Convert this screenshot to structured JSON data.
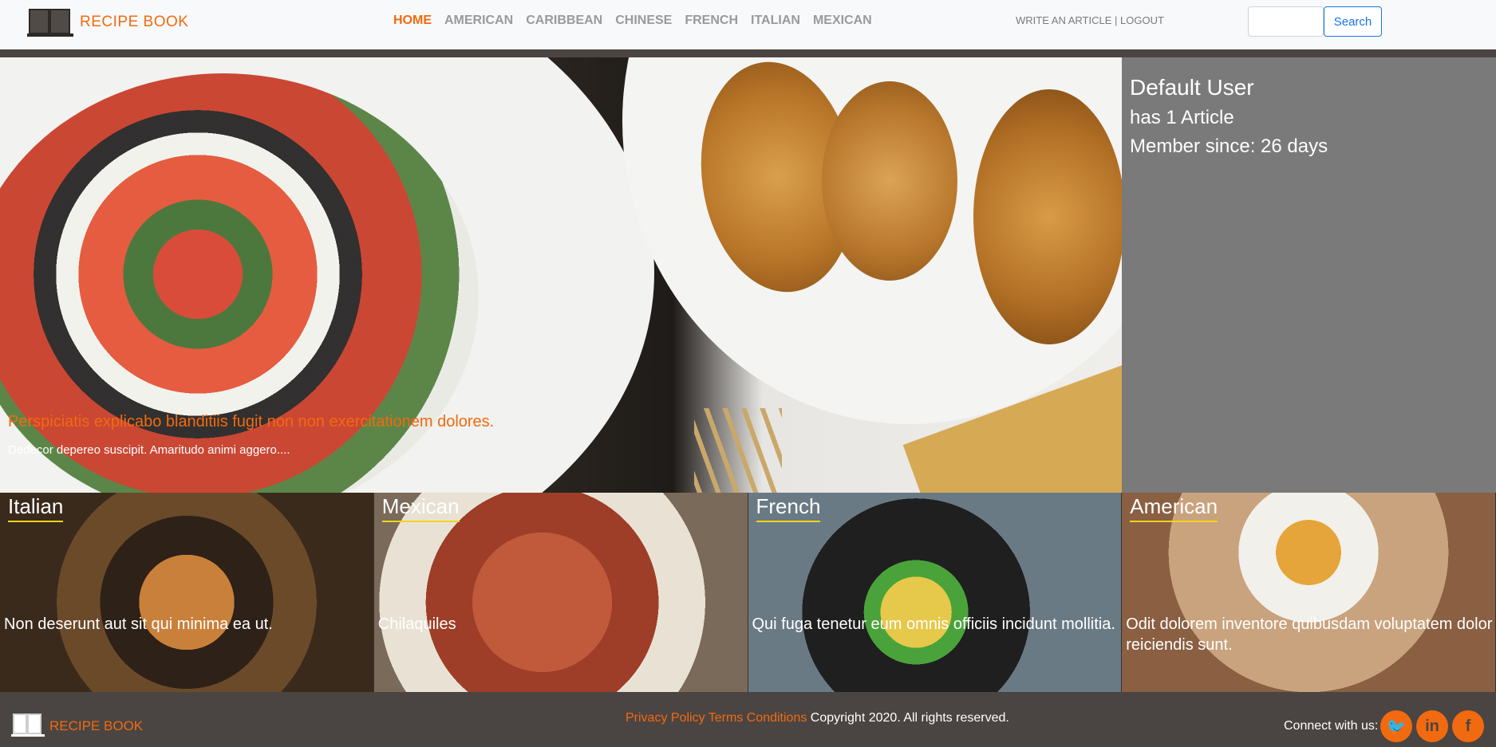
{
  "brand": {
    "name": "RECIPE BOOK"
  },
  "nav": {
    "links": [
      {
        "label": "HOME",
        "active": true
      },
      {
        "label": "AMERICAN",
        "active": false
      },
      {
        "label": "CARIBBEAN",
        "active": false
      },
      {
        "label": "CHINESE",
        "active": false
      },
      {
        "label": "FRENCH",
        "active": false
      },
      {
        "label": "ITALIAN",
        "active": false
      },
      {
        "label": "MEXICAN",
        "active": false
      }
    ],
    "write_article": "WRITE AN ARTICLE",
    "separator": "|",
    "logout": "LOGOUT"
  },
  "search": {
    "value": "",
    "button_label": "Search"
  },
  "hero": {
    "title": "Perspiciatis explicabo blanditiis fugit non non exercitationem dolores.",
    "subtitle": "Dedecor depereo suscipit. Amaritudo animi aggero...."
  },
  "profile": {
    "name": "Default User",
    "articles": "has 1 Article",
    "member_since": "Member since: 26 days"
  },
  "cards": [
    {
      "category": "Italian",
      "title": "Non deserunt aut sit qui minima ea ut."
    },
    {
      "category": "Mexican",
      "title": "Chilaquiles"
    },
    {
      "category": "French",
      "title": "Qui fuga tenetur eum omnis officiis incidunt mollitia."
    },
    {
      "category": "American",
      "title": "Odit dolorem inventore quibusdam voluptatem dolor reiciendis sunt."
    }
  ],
  "footer": {
    "brand": "RECIPE BOOK",
    "privacy": "Privacy Policy",
    "terms": "Terms Conditions",
    "copyright": "Copyright 2020. All rights reserved.",
    "connect": "Connect with us:",
    "social": [
      {
        "icon": "twitter-icon",
        "glyph": "🐦"
      },
      {
        "icon": "linkedin-icon",
        "glyph": "in"
      },
      {
        "icon": "facebook-icon",
        "glyph": "f"
      }
    ]
  },
  "colors": {
    "accent": "#f26a0f",
    "dark": "#4a4542",
    "panel": "#7a7a7a",
    "link_blue": "#1a73e8",
    "underline": "#f2d31a"
  }
}
